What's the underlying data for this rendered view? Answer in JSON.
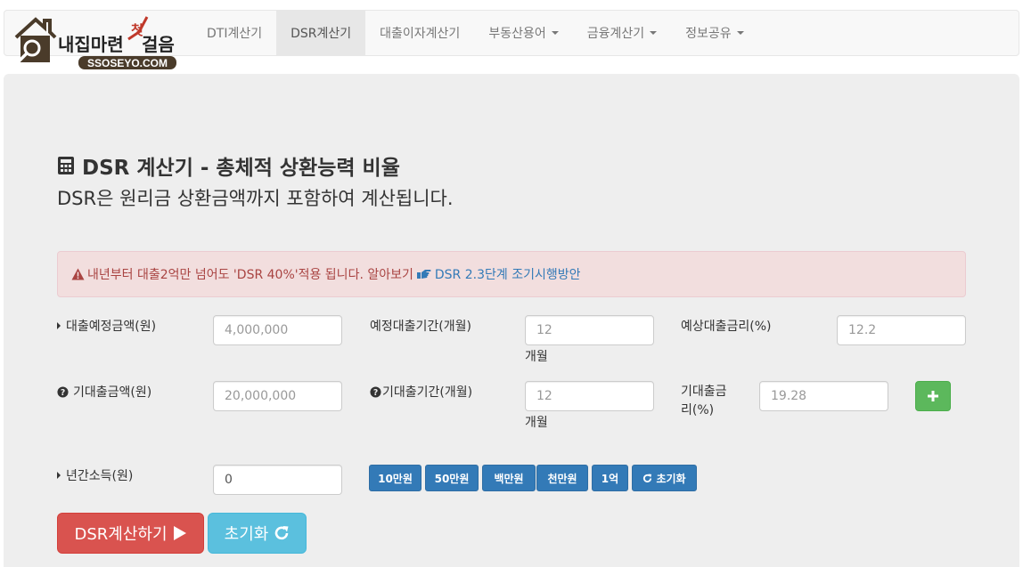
{
  "brand": {
    "text_main": "내집마련",
    "text_accent": "첫",
    "text_end": "걸음",
    "domain": "SSOSEYO.COM"
  },
  "nav": {
    "items": [
      {
        "label": "DTI계산기",
        "active": false,
        "dropdown": false
      },
      {
        "label": "DSR계산기",
        "active": true,
        "dropdown": false
      },
      {
        "label": "대출이자계산기",
        "active": false,
        "dropdown": false
      },
      {
        "label": "부동산용어",
        "active": false,
        "dropdown": true
      },
      {
        "label": "금융계산기",
        "active": false,
        "dropdown": true
      },
      {
        "label": "정보공유",
        "active": false,
        "dropdown": true
      }
    ]
  },
  "page": {
    "title": "DSR 계산기 - 총체적 상환능력 비율",
    "subtitle": "DSR은 원리금 상환금액까지 포함하여 계산됩니다."
  },
  "alert": {
    "text": "내년부터 대출2억만 넘어도 'DSR 40%'적용 됩니다. 알아보기",
    "link_text": "DSR 2.3단계 조기시행방안",
    "color": "#a94442"
  },
  "form": {
    "loan_amount_label": "대출예정금액(원)",
    "loan_amount_placeholder": "4,000,000",
    "loan_period_label": "예정대출기간(개월)",
    "loan_period_placeholder": "12",
    "loan_period_unit": "개월",
    "loan_rate_label": "예상대출금리(%)",
    "loan_rate_placeholder": "12.2",
    "existing_amount_label": "기대출금액(원)",
    "existing_amount_placeholder": "20,000,000",
    "existing_period_label": "기대출기간(개월)",
    "existing_period_placeholder": "12",
    "existing_period_unit": "개월",
    "existing_rate_label_1": "기대출금",
    "existing_rate_label_2": "리(%)",
    "existing_rate_placeholder": "19.28",
    "income_label": "년간소득(원)",
    "income_value": "0"
  },
  "quick_buttons": [
    "10만원",
    "50만원",
    "백만원",
    "천만원",
    "1억",
    "초기화"
  ],
  "actions": {
    "calculate_label": "DSR계산하기",
    "reset_label": "초기화"
  },
  "colors": {
    "primary": "#337ab7",
    "success": "#5cb85c",
    "danger": "#d9534f",
    "info": "#5bc0de"
  }
}
